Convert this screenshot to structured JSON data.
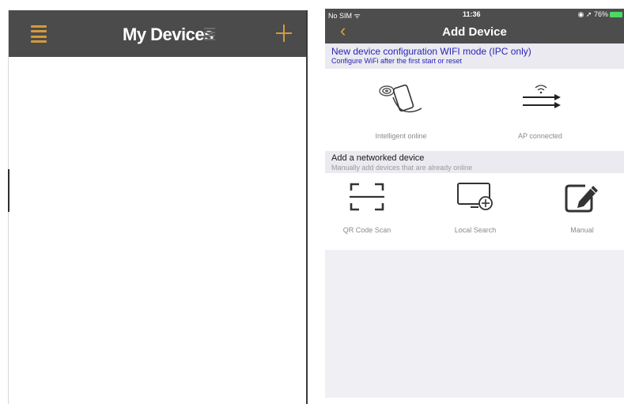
{
  "left_screen": {
    "title": "My Devices",
    "icons": {
      "menu": "hamburger-menu-icon",
      "sort": "list-icon",
      "add": "plus-icon"
    },
    "colors": {
      "header": "#4b4b4b",
      "accent": "#d39a3b"
    }
  },
  "right_screen": {
    "status_bar": {
      "carrier": "No SIM ᯤ",
      "time": "11:36",
      "right": "◉ ➚ 76%"
    },
    "nav": {
      "back_icon": "chevron-left-icon",
      "title": "Add Device"
    },
    "wifi_config": {
      "title": "New device configuration WIFI mode (IPC only)",
      "subtitle": "Configure WiFi after the first start or reset",
      "options": [
        {
          "label": "Intelligent online",
          "icon": "phone-wave-icon"
        },
        {
          "label": "AP connected",
          "icon": "wifi-transfer-icon"
        }
      ]
    },
    "networked": {
      "title": "Add a networked device",
      "subtitle": "Manually add devices that are already online",
      "options": [
        {
          "label": "QR Code Scan",
          "icon": "qr-scan-icon"
        },
        {
          "label": "Local Search",
          "icon": "monitor-search-icon"
        },
        {
          "label": "Manual",
          "icon": "edit-pencil-icon"
        }
      ]
    },
    "colors": {
      "nav": "#4d4d4d",
      "accent": "#e6a03c",
      "link_blue": "#2a24b8",
      "battery": "#4cd964"
    }
  }
}
